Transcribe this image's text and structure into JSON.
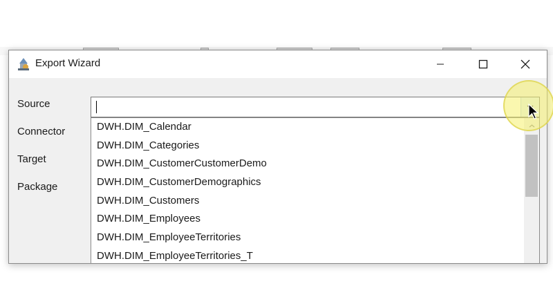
{
  "window": {
    "title": "Export Wizard",
    "icon": "wizard-icon",
    "controls": [
      "minimize-icon",
      "maximize-icon",
      "close-icon"
    ]
  },
  "form": {
    "labels": [
      "Source",
      "Connector",
      "Target",
      "Package"
    ],
    "source_value": ""
  },
  "dropdown": {
    "items": [
      "DWH.DIM_Calendar",
      "DWH.DIM_Categories",
      "DWH.DIM_CustomerCustomerDemo",
      "DWH.DIM_CustomerDemographics",
      "DWH.DIM_Customers",
      "DWH.DIM_Employees",
      "DWH.DIM_EmployeeTerritories",
      "DWH.DIM_EmployeeTerritories_T"
    ]
  },
  "colors": {
    "dialog_bg": "#f0f0f0",
    "accent": "#e5f1fb",
    "highlight": "#f5f06e"
  }
}
